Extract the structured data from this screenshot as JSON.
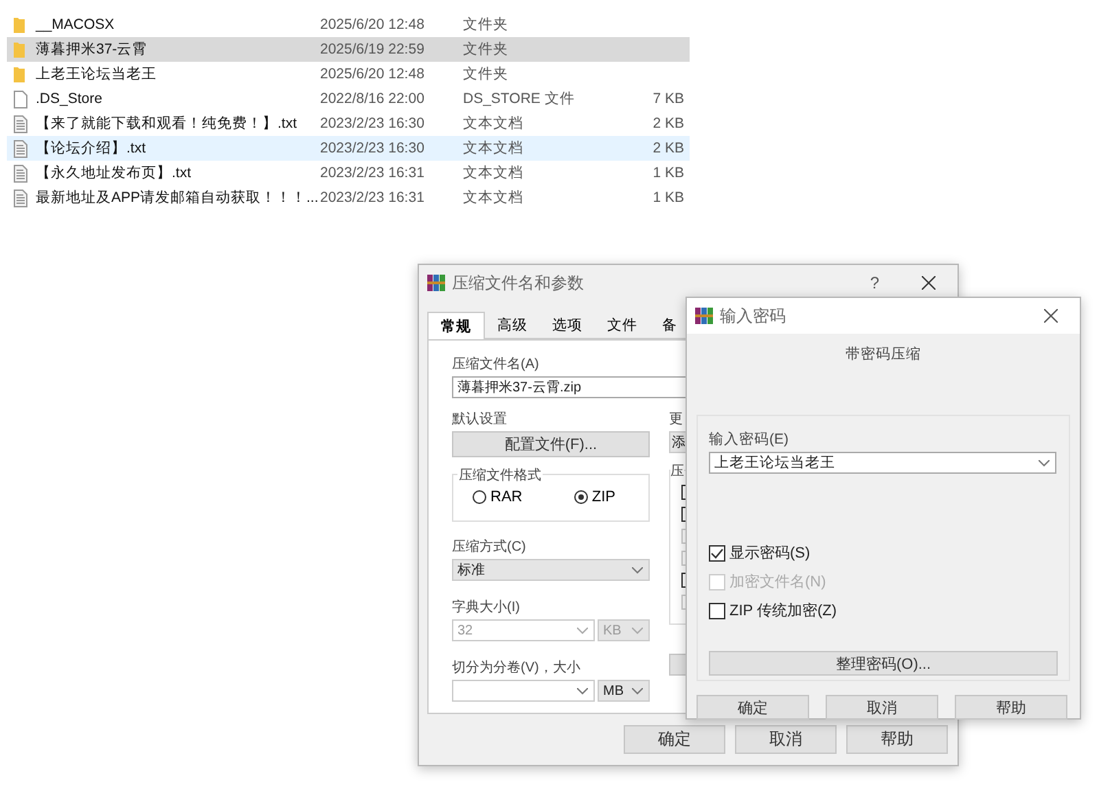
{
  "file_list": {
    "rows": [
      {
        "kind": "folder",
        "name": "__MACOSX",
        "date": "2025/6/20 12:48",
        "type": "文件夹",
        "selected": false,
        "hovered": false
      },
      {
        "kind": "folder",
        "name": "薄暮押米37-云霄",
        "date": "2025/6/19 22:59",
        "type": "文件夹",
        "selected": true,
        "hovered": false
      },
      {
        "kind": "folder",
        "name": "上老王论坛当老王",
        "date": "2025/6/20 12:48",
        "type": "文件夹",
        "selected": false,
        "hovered": false
      },
      {
        "kind": "file",
        "name": ".DS_Store",
        "date": "2022/8/16 22:00",
        "type": "DS_STORE 文件",
        "size": "7 KB",
        "selected": false,
        "hovered": false
      },
      {
        "kind": "text",
        "name": "【来了就能下载和观看！纯免费！】.txt",
        "date": "2023/2/23 16:30",
        "type": "文本文档",
        "size": "2 KB",
        "selected": false,
        "hovered": false
      },
      {
        "kind": "text",
        "name": "【论坛介绍】.txt",
        "date": "2023/2/23 16:30",
        "type": "文本文档",
        "size": "2 KB",
        "selected": false,
        "hovered": true
      },
      {
        "kind": "text",
        "name": "【永久地址发布页】.txt",
        "date": "2023/2/23 16:31",
        "type": "文本文档",
        "size": "1 KB",
        "selected": false,
        "hovered": false
      },
      {
        "kind": "text",
        "name": "最新地址及APP请发邮箱自动获取！！！...",
        "date": "2023/2/23 16:31",
        "type": "文本文档",
        "size": "1 KB",
        "selected": false,
        "hovered": false
      }
    ]
  },
  "archive_dialog": {
    "title": "压缩文件名和参数",
    "help_button": "?",
    "tabs": [
      {
        "label": "常规",
        "selected": true
      },
      {
        "label": "高级",
        "selected": false
      },
      {
        "label": "选项",
        "selected": false
      },
      {
        "label": "文件",
        "selected": false
      },
      {
        "label": "备",
        "selected": false
      }
    ],
    "archive_name": {
      "label": "压缩文件名(A)",
      "value": "薄暮押米37-云霄.zip"
    },
    "profile": {
      "label": "默认设置",
      "button": "配置文件(F)..."
    },
    "update": {
      "label": "更",
      "value": "添"
    },
    "format_group": {
      "title": "压缩文件格式",
      "options": [
        {
          "label": "RAR",
          "selected": false
        },
        {
          "label": "ZIP",
          "selected": true
        }
      ]
    },
    "method": {
      "label": "压缩方式(C)",
      "value": "标准"
    },
    "dictionary": {
      "label": "字典大小(I)",
      "value": "32",
      "unit": "KB",
      "disabled": true
    },
    "split": {
      "label": "切分为分卷(V)，大小",
      "unit": "MB"
    },
    "options_group": {
      "title": "压",
      "checkboxes": [
        {
          "disabled": false
        },
        {
          "disabled": false
        },
        {
          "disabled": true
        },
        {
          "disabled": true
        },
        {
          "disabled": false
        },
        {
          "disabled": true
        }
      ]
    },
    "buttons": [
      "确定",
      "取消",
      "帮助"
    ]
  },
  "password_dialog": {
    "title": "输入密码",
    "heading": "带密码压缩",
    "password": {
      "label": "输入密码(E)",
      "value": "上老王论坛当老王"
    },
    "checkboxes": [
      {
        "label": "显示密码(S)",
        "checked": true,
        "disabled": false
      },
      {
        "label": "加密文件名(N)",
        "checked": false,
        "disabled": true
      },
      {
        "label": "ZIP 传统加密(Z)",
        "checked": false,
        "disabled": false
      }
    ],
    "organize_button": "整理密码(O)...",
    "buttons": [
      "确定",
      "取消",
      "帮助"
    ]
  }
}
